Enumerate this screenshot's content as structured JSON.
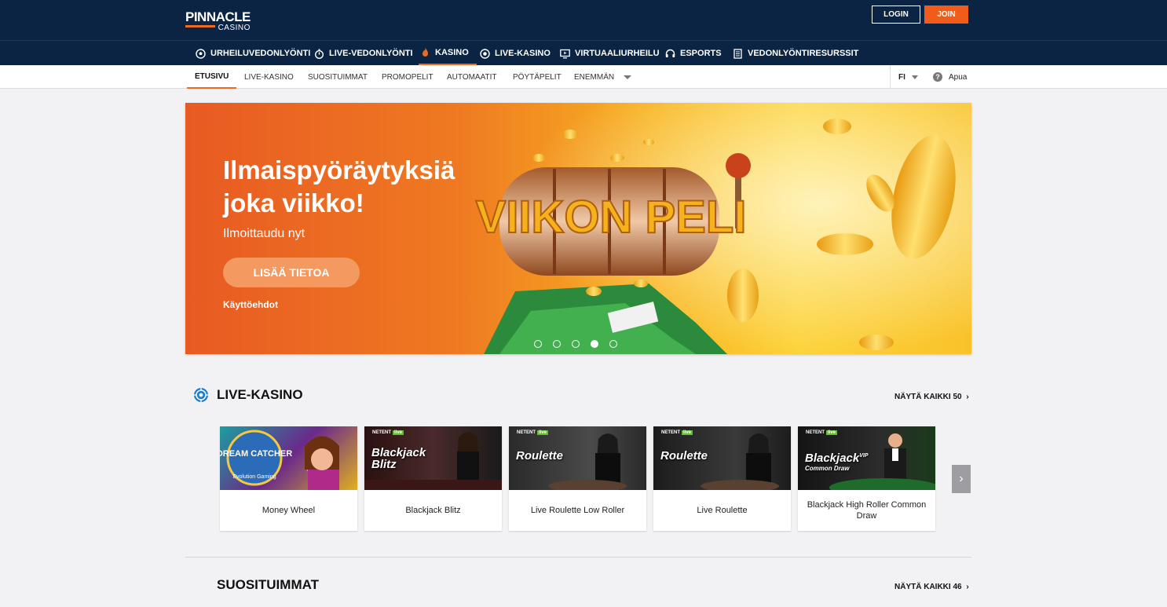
{
  "header": {
    "logo_brand": "PINNACLE",
    "logo_sub": "CASINO",
    "login_label": "LOGIN",
    "join_label": "JOIN",
    "accent": "#ef6a1e",
    "background": "#0b2443"
  },
  "main_nav": {
    "items": [
      {
        "label": "URHEILUVEDONLYÖNTI",
        "icon": "soccer-ball-icon"
      },
      {
        "label": "LIVE-VEDONLYÖNTI",
        "icon": "stopwatch-icon"
      },
      {
        "label": "KASINO",
        "icon": "flame-icon"
      },
      {
        "label": "LIVE-KASINO",
        "icon": "roulette-icon"
      },
      {
        "label": "VIRTUAALIURHEILU",
        "icon": "monitor-icon"
      },
      {
        "label": "ESPORTS",
        "icon": "headset-icon"
      },
      {
        "label": "VEDONLYÖNTIRESURSSIT",
        "icon": "document-icon"
      }
    ],
    "active": "KASINO"
  },
  "sub_nav": {
    "items": [
      {
        "label": "ETUSIVU"
      },
      {
        "label": "LIVE-KASINO"
      },
      {
        "label": "SUOSITUIMMAT"
      },
      {
        "label": "PROMOPELIT"
      },
      {
        "label": "AUTOMAATIT"
      },
      {
        "label": "PÖYTÄPELIT"
      },
      {
        "label": "ENEMMÄN"
      }
    ],
    "active": "ETUSIVU",
    "language": "FI",
    "help_label": "Apua"
  },
  "hero": {
    "title": "Ilmaispyöräytyksiä joka viikko!",
    "subtitle": "Ilmoittaudu nyt",
    "button_label": "LISÄÄ TIETOA",
    "terms_label": "Käyttöehdot",
    "art_text": "VIIKON PELI",
    "slides_count": 5,
    "active_slide": 4
  },
  "live_casino": {
    "title": "LIVE-KASINO",
    "see_all_label": "NÄYTÄ KAIKKI 50",
    "games": [
      {
        "name": "Money Wheel",
        "thumb_text": "DREAM CATCHER",
        "thumb_sub": "Evolution Gaming",
        "provider": ""
      },
      {
        "name": "Blackjack Blitz",
        "thumb_text": "Blackjack Blitz",
        "provider": "NETENT",
        "badge": "live"
      },
      {
        "name": "Live Roulette Low Roller",
        "thumb_text": "Roulette",
        "provider": "NETENT",
        "badge": "live"
      },
      {
        "name": "Live Roulette",
        "thumb_text": "Roulette",
        "provider": "NETENT",
        "badge": "live"
      },
      {
        "name": "Blackjack High Roller Common Draw",
        "thumb_text": "Blackjack",
        "thumb_sub": "Common Draw",
        "thumb_vip": "VIP",
        "provider": "NETENT",
        "badge": "live"
      }
    ]
  },
  "popular": {
    "title": "SUOSITUIMMAT",
    "see_all_label": "NÄYTÄ KAIKKI 46"
  }
}
